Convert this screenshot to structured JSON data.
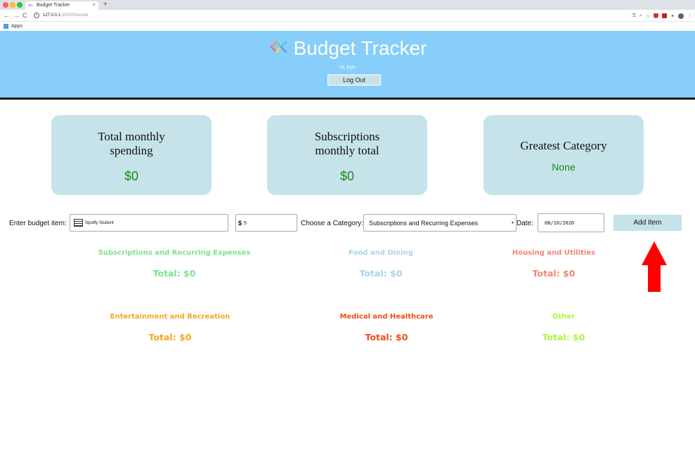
{
  "browser": {
    "tab_title": "Budget Tracker",
    "tab_close": "×",
    "new_tab": "+",
    "url_host": "127.0.0.1",
    "url_path": ":3000/#/tracker",
    "bookmarks_apps": "Apps",
    "nav_back": "←",
    "nav_forward": "→",
    "nav_reload": "C"
  },
  "header": {
    "title": "Budget Tracker",
    "greeting": "Hi, kyle",
    "logout_label": "Log Out",
    "background": "#87cefa"
  },
  "summary": {
    "total_monthly_title": "Total monthly spending",
    "total_monthly_value": "$0",
    "subscriptions_title": "Subscriptions monthly total",
    "subscriptions_value": "$0",
    "greatest_title": "Greatest Category",
    "greatest_value": "None"
  },
  "form": {
    "item_label": "Enter budget item:",
    "item_value": "Spotify Student",
    "currency_symbol": "$",
    "amount_value": "5",
    "category_label": "Choose a Category:",
    "category_value": "Subscriptions and Recurring Expenses",
    "date_label": "Date:",
    "date_value": "08/10/2020",
    "add_label": "Add Item"
  },
  "categories": [
    {
      "name": "Subscriptions and Recurring Expenses",
      "total": "Total: $0",
      "color": "#7fe18c"
    },
    {
      "name": "Food and Dining",
      "total": "Total: $0",
      "color": "#a8d5ea"
    },
    {
      "name": "Housing and Utilities",
      "total": "Total: $0",
      "color": "#f58575"
    },
    {
      "name": "Entertainment and Recreation",
      "total": "Total: $0",
      "color": "#f5a623"
    },
    {
      "name": "Medical and Healthcare",
      "total": "Total: $0",
      "color": "#f04e19"
    },
    {
      "name": "Other",
      "total": "Total: $0",
      "color": "#adf542"
    }
  ],
  "colors": {
    "card_bg": "#c6e3ea",
    "money_green": "#1a8b1a",
    "annotation_arrow": "#ff0000"
  }
}
